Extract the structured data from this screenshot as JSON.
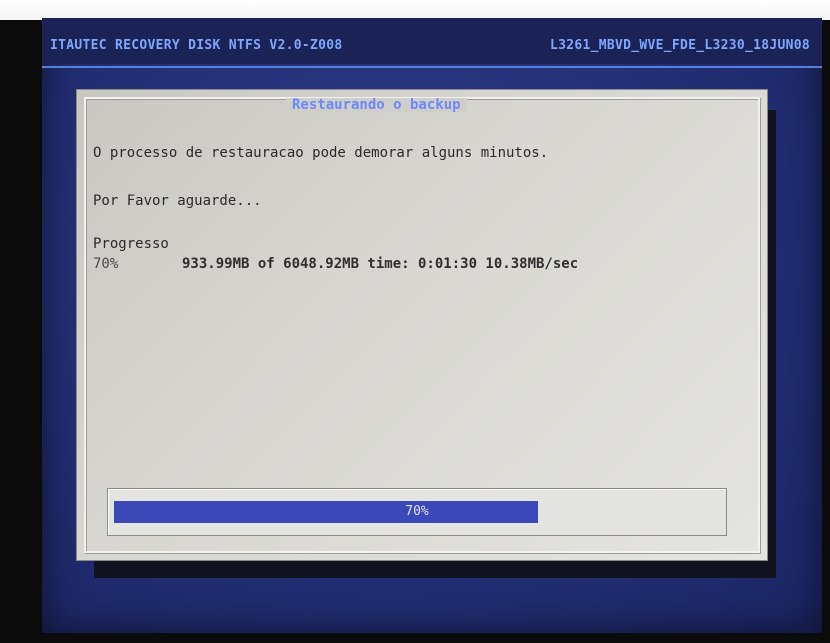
{
  "header": {
    "left_text": "ITAUTEC RECOVERY DISK NTFS V2.0-Z008",
    "right_text": "L3261_MBVD_WVE_FDE_L3230_18JUN08"
  },
  "dialog": {
    "title": "Restaurando o backup",
    "message": "O processo de restauracao pode demorar alguns minutos.",
    "wait_text": "Por Favor aguarde...",
    "progress_label": "Progresso",
    "percent": "70%",
    "stats": "933.99MB of 6048.92MB  time: 0:01:30  10.38MB/sec"
  },
  "progress_bar": {
    "fraction": 0.7,
    "label": "70%"
  },
  "colors": {
    "screen_blue": "#25327a",
    "header_text": "#7fa7ff",
    "title_text": "#6d88ff",
    "bar_fill": "#3b49b8"
  }
}
